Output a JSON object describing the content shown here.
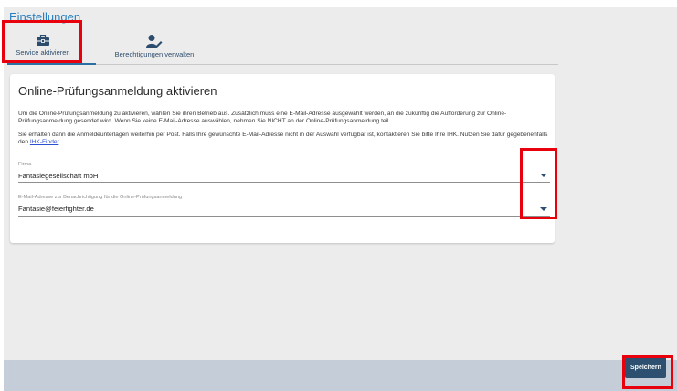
{
  "header": {
    "title": "Einstellungen"
  },
  "tabs": [
    {
      "label": "Service aktivieren",
      "icon": "toolbox-icon"
    },
    {
      "label": "Berechtigungen verwalten",
      "icon": "user-edit-icon"
    }
  ],
  "card": {
    "title": "Online-Prüfungsanmeldung aktivieren",
    "paragraph1": "Um die Online-Prüfungsanmeldung zu aktivieren, wählen Sie ihren Betrieb aus. Zusätzlich muss eine E-Mail-Adresse ausgewählt werden, an die zukünftig die Aufforderung zur Online-Prüfungsanmeldung gesendet wird. Wenn Sie keine E-Mail-Adresse auswählen, nehmen Sie NICHT an der Online-Prüfungsanmeldung teil.",
    "paragraph2": "Sie erhalten dann die Anmeldeunterlagen weiterhin per Post. Falls Ihre gewünschte E-Mail-Adresse nicht in der Auswahl verfügbar ist, kontaktieren Sie bitte Ihre IHK. Nutzen Sie dafür gegebenenfalls den ",
    "link": "IHK-Finder",
    "paragraph2_end": ".",
    "fields": [
      {
        "label": "Firma",
        "value": "Fantasiegesellschaft mbH"
      },
      {
        "label": "E-Mail-Adresse zur Benachrichtigung für die Online-Prüfungsanmeldung",
        "value": "Fantasie@feierfighter.de"
      }
    ]
  },
  "footer": {
    "save_label": "Speichern"
  },
  "colors": {
    "accent": "#2a7fc0",
    "primary": "#2d5070",
    "highlight": "#e8000c",
    "footer_bg": "#c4cdd8"
  }
}
